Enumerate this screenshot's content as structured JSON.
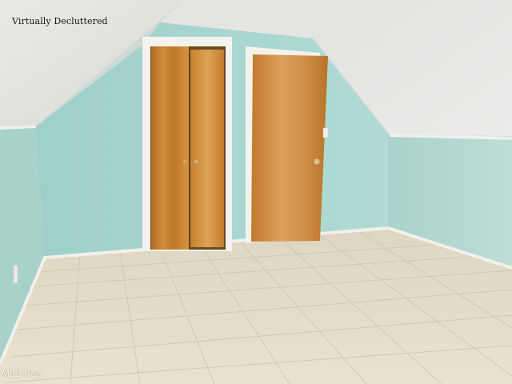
{
  "overlay": {
    "caption": "Virtually Decluttered",
    "watermark": "MLS Now"
  },
  "colors": {
    "wall": "#a9d6cf",
    "ceiling": "#e6e6e2",
    "floor": "#e4dcc6",
    "trim": "#f3f1ea",
    "wood": "#c8852f"
  }
}
